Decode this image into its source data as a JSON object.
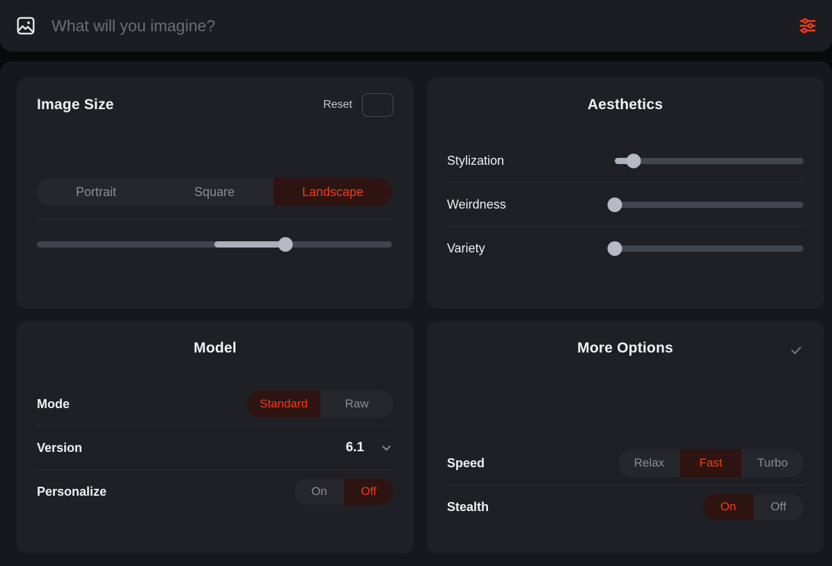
{
  "topbar": {
    "image_icon": "image-icon",
    "prompt_placeholder": "What will you imagine?",
    "prompt_value": "",
    "settings_icon": "sliders-icon",
    "accent_color": "#f5391a"
  },
  "panels": {
    "image_size": {
      "title": "Image Size",
      "reset_label": "Reset",
      "ratio_preview_icon": "aspect-ratio-box-icon",
      "options": [
        "Portrait",
        "Square",
        "Landscape"
      ],
      "selected": "Landscape",
      "slider": {
        "name": "size-slider",
        "value": 70,
        "fill_start": 50,
        "min": 0,
        "max": 100
      }
    },
    "aesthetics": {
      "title": "Aesthetics",
      "rows": [
        {
          "label": "Stylization",
          "value": 10,
          "fill_start": 0,
          "min": 0,
          "max": 100
        },
        {
          "label": "Weirdness",
          "value": 0,
          "fill_start": 0,
          "min": 0,
          "max": 100
        },
        {
          "label": "Variety",
          "value": 0,
          "fill_start": 0,
          "min": 0,
          "max": 100
        }
      ]
    },
    "model": {
      "title": "Model",
      "mode": {
        "label": "Mode",
        "options": [
          "Standard",
          "Raw"
        ],
        "selected": "Standard"
      },
      "version": {
        "label": "Version",
        "value": "6.1",
        "chevron_icon": "chevron-down-icon"
      },
      "personalize": {
        "label": "Personalize",
        "options": [
          "On",
          "Off"
        ],
        "selected": "Off"
      }
    },
    "more_options": {
      "title": "More Options",
      "header_icon": "check-icon",
      "speed": {
        "label": "Speed",
        "options": [
          "Relax",
          "Fast",
          "Turbo"
        ],
        "selected": "Fast"
      },
      "stealth": {
        "label": "Stealth",
        "options": [
          "On",
          "Off"
        ],
        "selected": "On"
      }
    }
  }
}
